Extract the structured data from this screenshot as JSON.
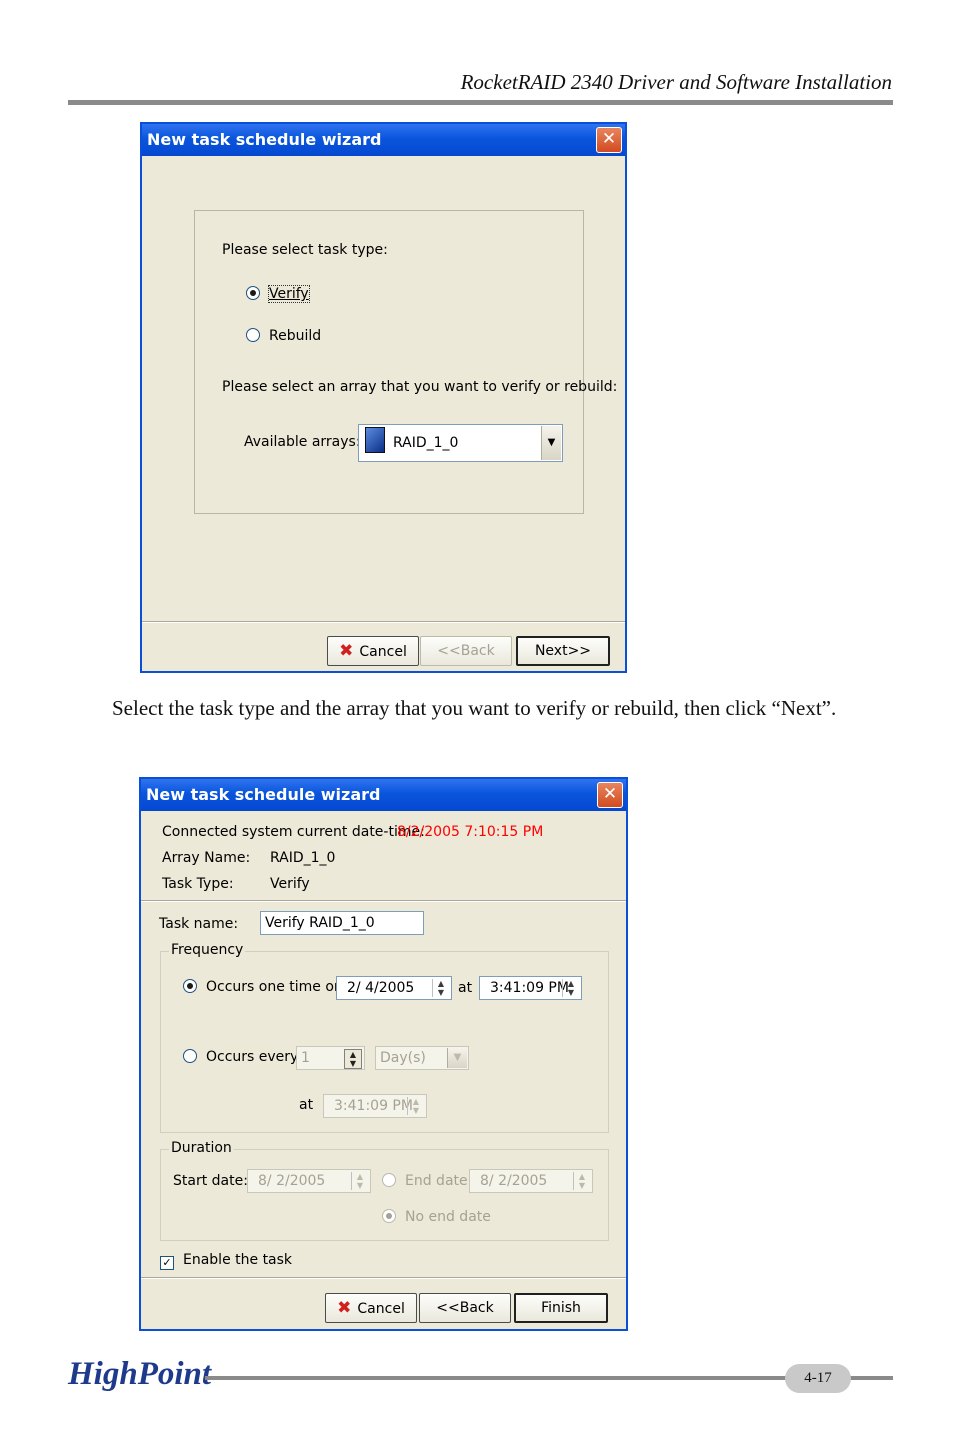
{
  "header": {
    "title": "RocketRAID 2340 Driver and Software Installation"
  },
  "dialog1": {
    "title": "New task schedule wizard",
    "close_glyph": "✕",
    "prompt_task_type": "Please select task type:",
    "option_verify": "Verify",
    "option_rebuild": "Rebuild",
    "selected_task": "Verify",
    "prompt_array": "Please select an array that you want to verify or rebuild:",
    "arrays_label": "Available arrays:",
    "arrays_value": "RAID_1_0",
    "cancel_label": "Cancel",
    "back_label": "<<Back",
    "next_label": "Next>>"
  },
  "caption": "Select the task type and the array that you want to verify or rebuild, then click “Next”.",
  "dialog2": {
    "title": "New task schedule wizard",
    "close_glyph": "✕",
    "datetime_label": "Connected system current date-time:",
    "datetime_value": "8/2/2005 7:10:15 PM",
    "datetime_color": "#ff0000",
    "array_name_label": "Array Name:",
    "array_name_value": "RAID_1_0",
    "task_type_label": "Task Type:",
    "task_type_value": "Verify",
    "task_name_label": "Task name:",
    "task_name_value": "Verify RAID_1_0",
    "frequency_legend": "Frequency",
    "occurs_once_label": "Occurs one time on",
    "once_date": "2/  4/2005",
    "at_label": "at",
    "once_time": "3:41:09 PM",
    "occurs_every_label": "Occurs every",
    "every_count": "1",
    "every_unit": "Day(s)",
    "every_at_label": "at",
    "every_time": "3:41:09 PM",
    "duration_legend": "Duration",
    "start_date_label": "Start date:",
    "start_date_value": "8/  2/2005",
    "end_date_label": "End date",
    "end_date_value": "8/  2/2005",
    "no_end_date_label": "No end date",
    "enable_task_label": "Enable the task",
    "enable_task_checked": true,
    "cancel_label": "Cancel",
    "back_label": "<<Back",
    "finish_label": "Finish"
  },
  "footer": {
    "brand": "HighPoint",
    "page_number": "4-17"
  }
}
